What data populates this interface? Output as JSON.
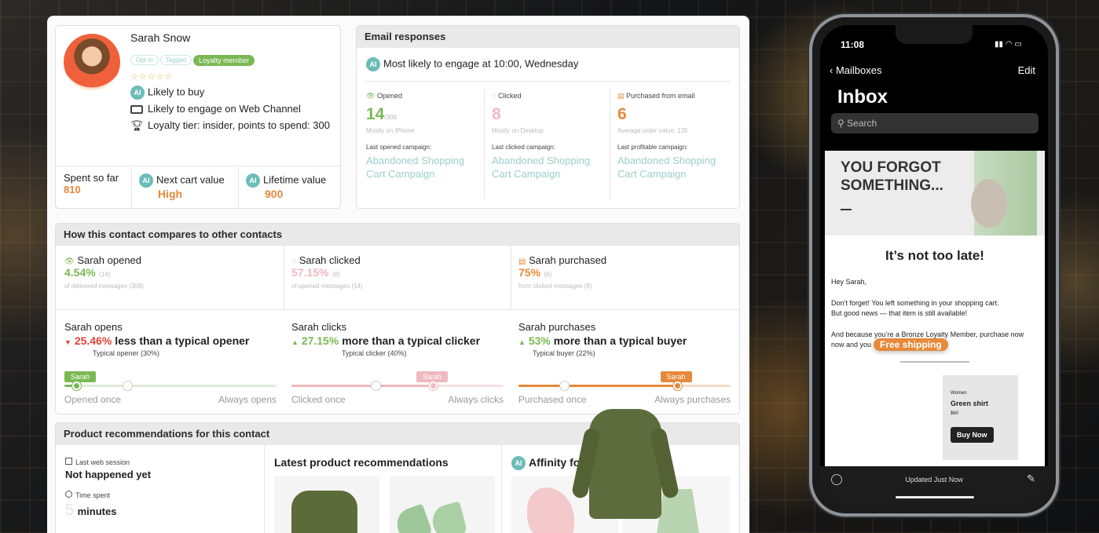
{
  "profile": {
    "name": "Sarah Snow",
    "chips": [
      "Opt-in",
      "Tagged"
    ],
    "loyalty_chip": "Loyalty member",
    "stars": "☆☆☆☆☆",
    "likely_buy": "Likely to buy",
    "web_channel": "Likely to engage on Web Channel",
    "loyalty_tier": "Loyalty tier: insider, points to spend: 300",
    "spent_label": "Spent so far",
    "spent_value": "810",
    "next_cart_label": "Next cart value",
    "next_cart_value": "High",
    "lifetime_label": "Lifetime value",
    "lifetime_value": "900",
    "ai": "AI"
  },
  "email": {
    "title": "Email responses",
    "engage": "Most likely to engage at 10:00, Wednesday",
    "cols": [
      {
        "label": "Opened",
        "value": "14",
        "sub": "/308",
        "note": "Mostly on iPhone",
        "last_label": "Last opened campaign:",
        "campaign": "Abandoned Shopping Cart Campaign"
      },
      {
        "label": "Clicked",
        "value": "8",
        "sub": "",
        "note": "Mostly on Desktop",
        "last_label": "Last clicked campaign:",
        "campaign": "Abandoned Shopping Cart Campaign"
      },
      {
        "label": "Purchased from email",
        "value": "6",
        "sub": "",
        "note": "Average order value: 135",
        "last_label": "Last profitable campaign:",
        "campaign": "Abandoned Shopping Cart Campaign"
      }
    ]
  },
  "compare": {
    "title": "How this contact compares to other contacts",
    "stats": [
      {
        "label": "Sarah opened",
        "pct": "4.54%",
        "count": "(14)",
        "note": "of delivered messages (308)"
      },
      {
        "label": "Sarah clicked",
        "pct": "57.15%",
        "count": "(8)",
        "note": "of opened messages (14)"
      },
      {
        "label": "Sarah purchased",
        "pct": "75%",
        "count": "(6)",
        "note": "from clicked messages (8)"
      }
    ],
    "rows": [
      {
        "title": "Sarah opens",
        "delta": "25.46%",
        "direction": "down",
        "text": "less than a typical opener",
        "typical": "Typical opener (30%)",
        "tag": "Sarah",
        "left": "Opened once",
        "right": "Always opens",
        "position": 0.06,
        "typical_position": 0.3
      },
      {
        "title": "Sarah clicks",
        "delta": "27.15%",
        "direction": "up",
        "text": "more than a typical clicker",
        "typical": "Typical clicker (40%)",
        "tag": "Sarah",
        "left": "Clicked once",
        "right": "Always clicks",
        "position": 0.67,
        "typical_position": 0.4
      },
      {
        "title": "Sarah purchases",
        "delta": "53%",
        "direction": "up",
        "text": "more than a typical buyer",
        "typical": "Typical buyer (22%)",
        "tag": "Sarah",
        "left": "Purchased once",
        "right": "Always purchases",
        "position": 0.75,
        "typical_position": 0.22
      }
    ]
  },
  "products": {
    "title": "Product recommendations for this contact",
    "last_session_label": "Last web session",
    "last_session_value": "Not happened yet",
    "time_spent_label": "Time spent",
    "time_spent_num": "5",
    "time_spent_unit": "minutes",
    "latest_title": "Latest product recommendations",
    "affinity_title": "Affinity fo"
  },
  "phone": {
    "time": "11:08",
    "back": "Mailboxes",
    "edit": "Edit",
    "inbox": "Inbox",
    "search": "Search",
    "hero": "YOU FORGOT SOMETHING...",
    "headline": "It’s not too late!",
    "greeting": "Hey Sarah,",
    "body1": "Don’t forget! You left something in your shopping cart.",
    "body2": "But good news — that item is still available!",
    "body3": "And because you’re a Bronze Loyalty Member, purchase now",
    "body4": "now and you",
    "free_shipping": "Free shipping",
    "product_cat": "Women",
    "product_name": "Green shirt",
    "price": "$60",
    "buy": "Buy Now",
    "updated": "Updated Just Now"
  },
  "colors": {
    "green": "#7ab854",
    "pink": "#f0b8c0",
    "orange": "#e6893a",
    "teal": "#6cbdb8"
  }
}
